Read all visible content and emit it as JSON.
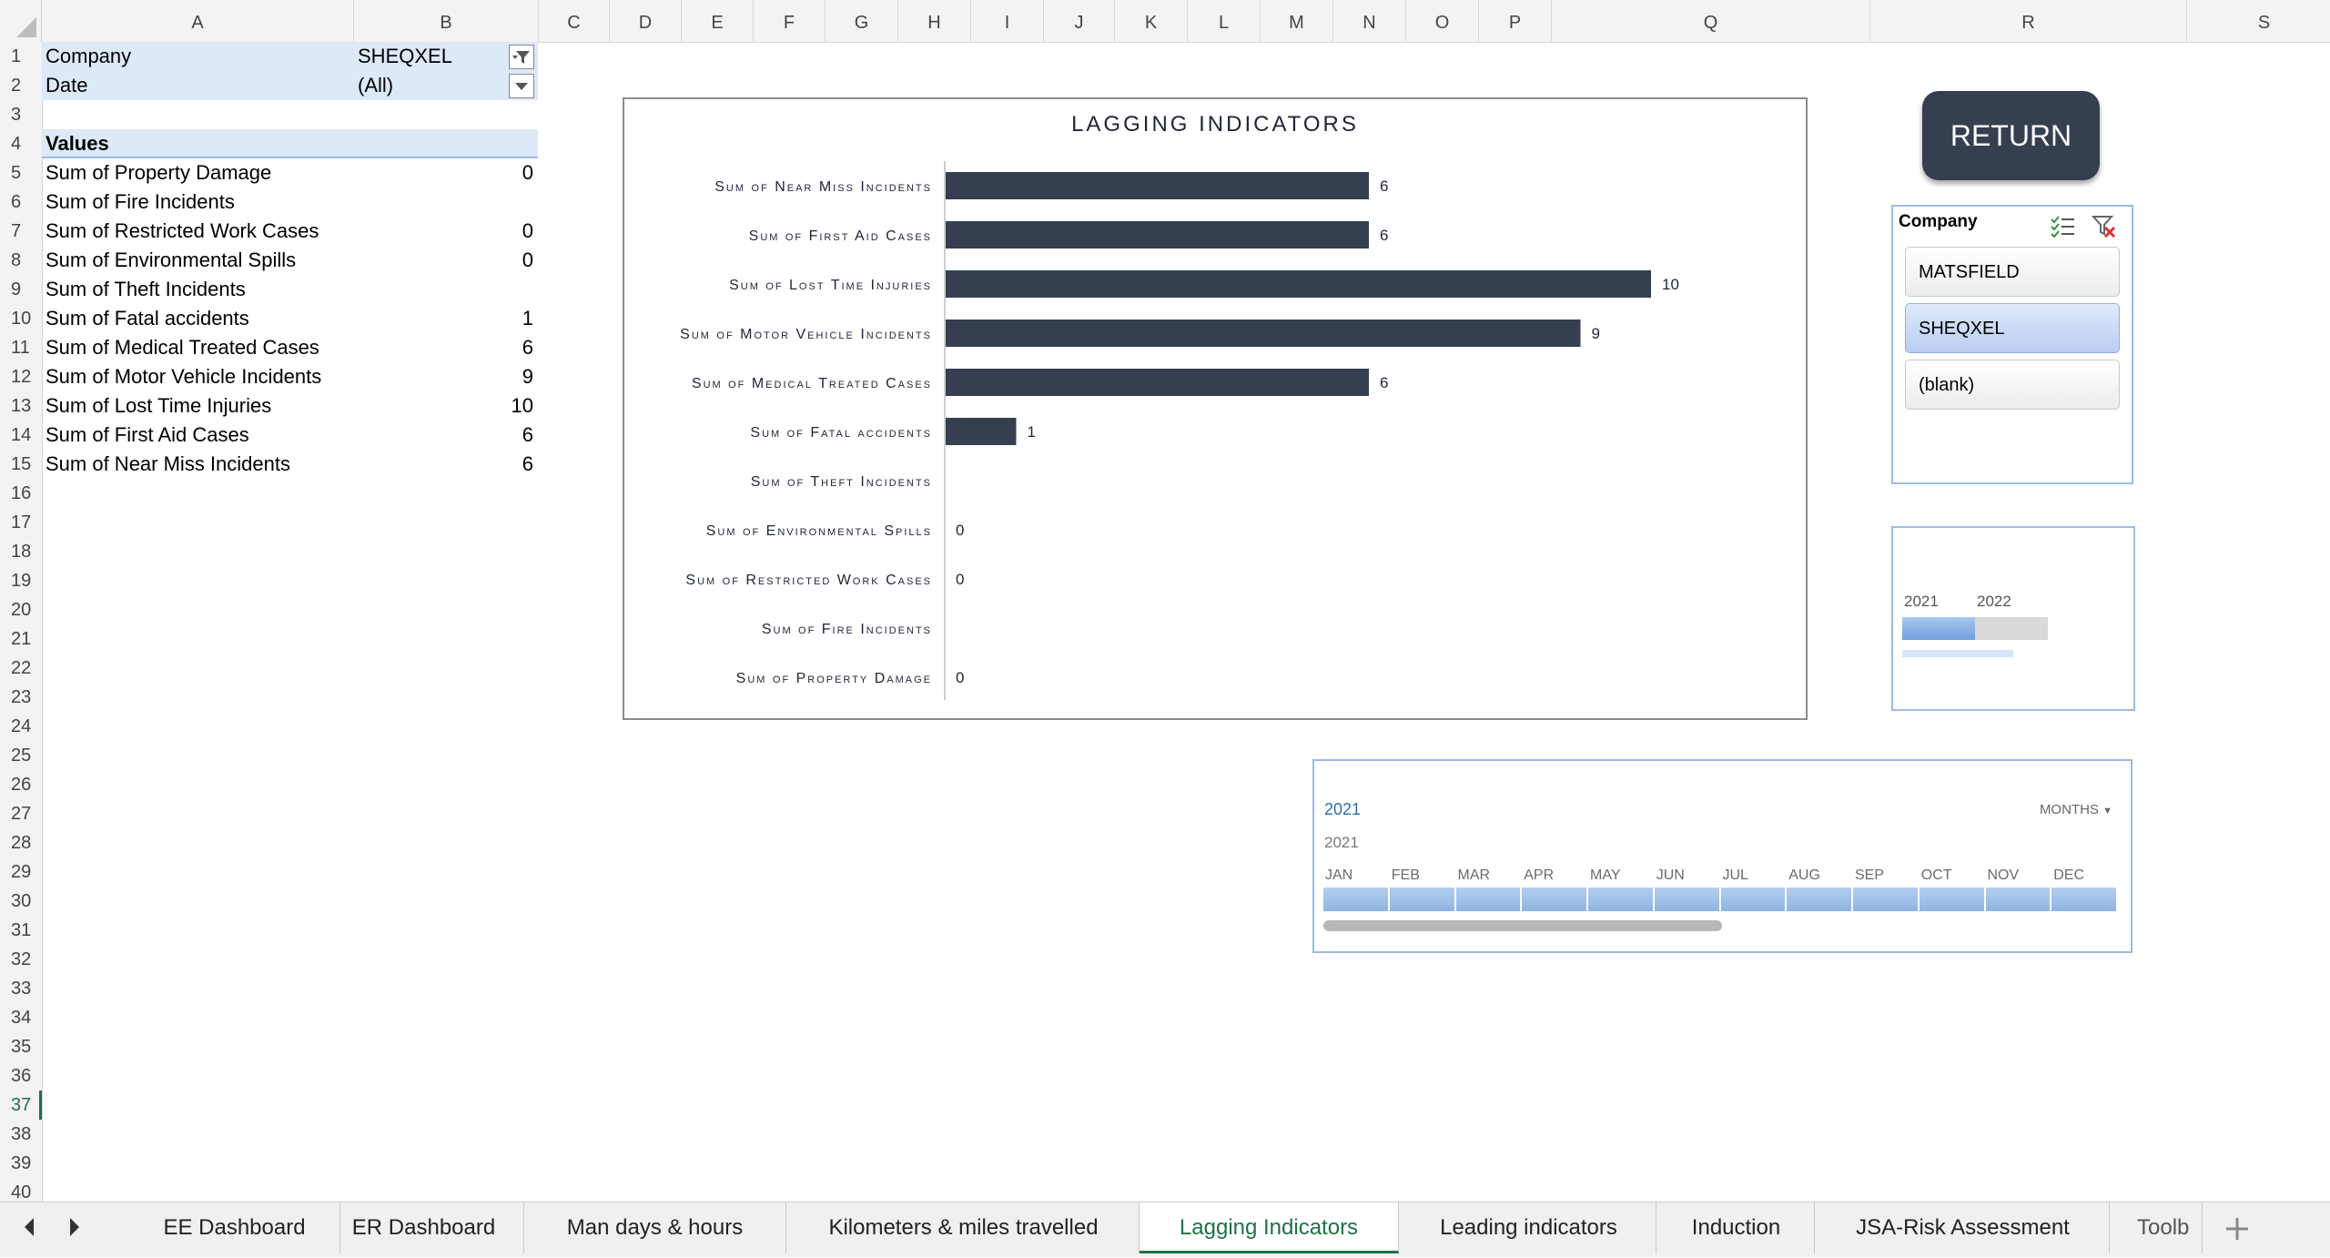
{
  "columns": [
    "A",
    "B",
    "C",
    "D",
    "E",
    "F",
    "G",
    "H",
    "I",
    "J",
    "K",
    "L",
    "M",
    "N",
    "O",
    "P",
    "Q",
    "R",
    "S"
  ],
  "rows": [
    "1",
    "2",
    "3",
    "4",
    "5",
    "6",
    "7",
    "8",
    "9",
    "10",
    "11",
    "12",
    "13",
    "14",
    "15",
    "16",
    "17",
    "18",
    "19",
    "20",
    "21",
    "22",
    "23",
    "24",
    "25",
    "26",
    "27",
    "28",
    "29",
    "30",
    "31",
    "32",
    "33",
    "34",
    "35",
    "36",
    "37",
    "38",
    "39",
    "40"
  ],
  "active_row": "37",
  "pivot": {
    "filters": [
      {
        "label": "Company",
        "value": "SHEQXEL"
      },
      {
        "label": "Date",
        "value": "(All)"
      }
    ],
    "values_header": "Values",
    "rows": [
      {
        "label": "Sum of Property Damage",
        "value": "0"
      },
      {
        "label": "Sum of Fire Incidents",
        "value": ""
      },
      {
        "label": "Sum of Restricted Work Cases",
        "value": "0"
      },
      {
        "label": "Sum of Environmental Spills",
        "value": "0"
      },
      {
        "label": "Sum of Theft Incidents",
        "value": ""
      },
      {
        "label": "Sum of Fatal accidents",
        "value": "1"
      },
      {
        "label": "Sum of Medical Treated Cases",
        "value": "6"
      },
      {
        "label": "Sum of Motor Vehicle Incidents",
        "value": "9"
      },
      {
        "label": "Sum of Lost Time Injuries",
        "value": "10"
      },
      {
        "label": "Sum of First Aid Cases",
        "value": "6"
      },
      {
        "label": "Sum of Near Miss Incidents",
        "value": "6"
      }
    ]
  },
  "chart_data": {
    "type": "bar",
    "orientation": "horizontal",
    "title": "LAGGING INDICATORS",
    "categories": [
      "Sum of Near Miss Incidents",
      "Sum of First Aid Cases",
      "Sum of Lost Time Injuries",
      "Sum of Motor Vehicle Incidents",
      "Sum of Medical Treated Cases",
      "Sum of Fatal accidents",
      "Sum of Theft Incidents",
      "Sum of Environmental Spills",
      "Sum of Restricted Work Cases",
      "Sum of Fire Incidents",
      "Sum of Property Damage"
    ],
    "values": [
      6,
      6,
      10,
      9,
      6,
      1,
      null,
      0,
      0,
      null,
      0
    ],
    "data_labels": [
      "6",
      "6",
      "10",
      "9",
      "6",
      "1",
      "",
      "0",
      "0",
      "",
      "0"
    ],
    "xlim": [
      0,
      13
    ],
    "grid": false,
    "legend": "none",
    "bar_color": "#353f4f"
  },
  "return_button": {
    "label": "RETURN"
  },
  "slicer": {
    "title": "Company",
    "items": [
      {
        "label": "MATSFIELD",
        "selected": false
      },
      {
        "label": "SHEQXEL",
        "selected": true
      },
      {
        "label": "(blank)",
        "selected": false
      }
    ]
  },
  "timeline_small": {
    "years": [
      "2021",
      "2022"
    ]
  },
  "timeline": {
    "selection_label": "2021",
    "level": "MONTHS",
    "year": "2021",
    "months": [
      "JAN",
      "FEB",
      "MAR",
      "APR",
      "MAY",
      "JUN",
      "JUL",
      "AUG",
      "SEP",
      "OCT",
      "NOV",
      "DEC"
    ]
  },
  "tabs": [
    {
      "label": "EE Dashboard",
      "active": false
    },
    {
      "label": "ER Dashboard",
      "active": false
    },
    {
      "label": "Man days & hours",
      "active": false
    },
    {
      "label": "Kilometers & miles travelled",
      "active": false
    },
    {
      "label": "Lagging Indicators",
      "active": true
    },
    {
      "label": "Leading indicators",
      "active": false
    },
    {
      "label": "Induction",
      "active": false
    },
    {
      "label": "JSA-Risk Assessment",
      "active": false
    },
    {
      "label": "Toolb",
      "active": false
    }
  ],
  "colors": {
    "accent": "#1e7145",
    "bar": "#353f4f",
    "slicer_border": "#9cbbe4",
    "timeline_fill": "#8db4e2"
  }
}
